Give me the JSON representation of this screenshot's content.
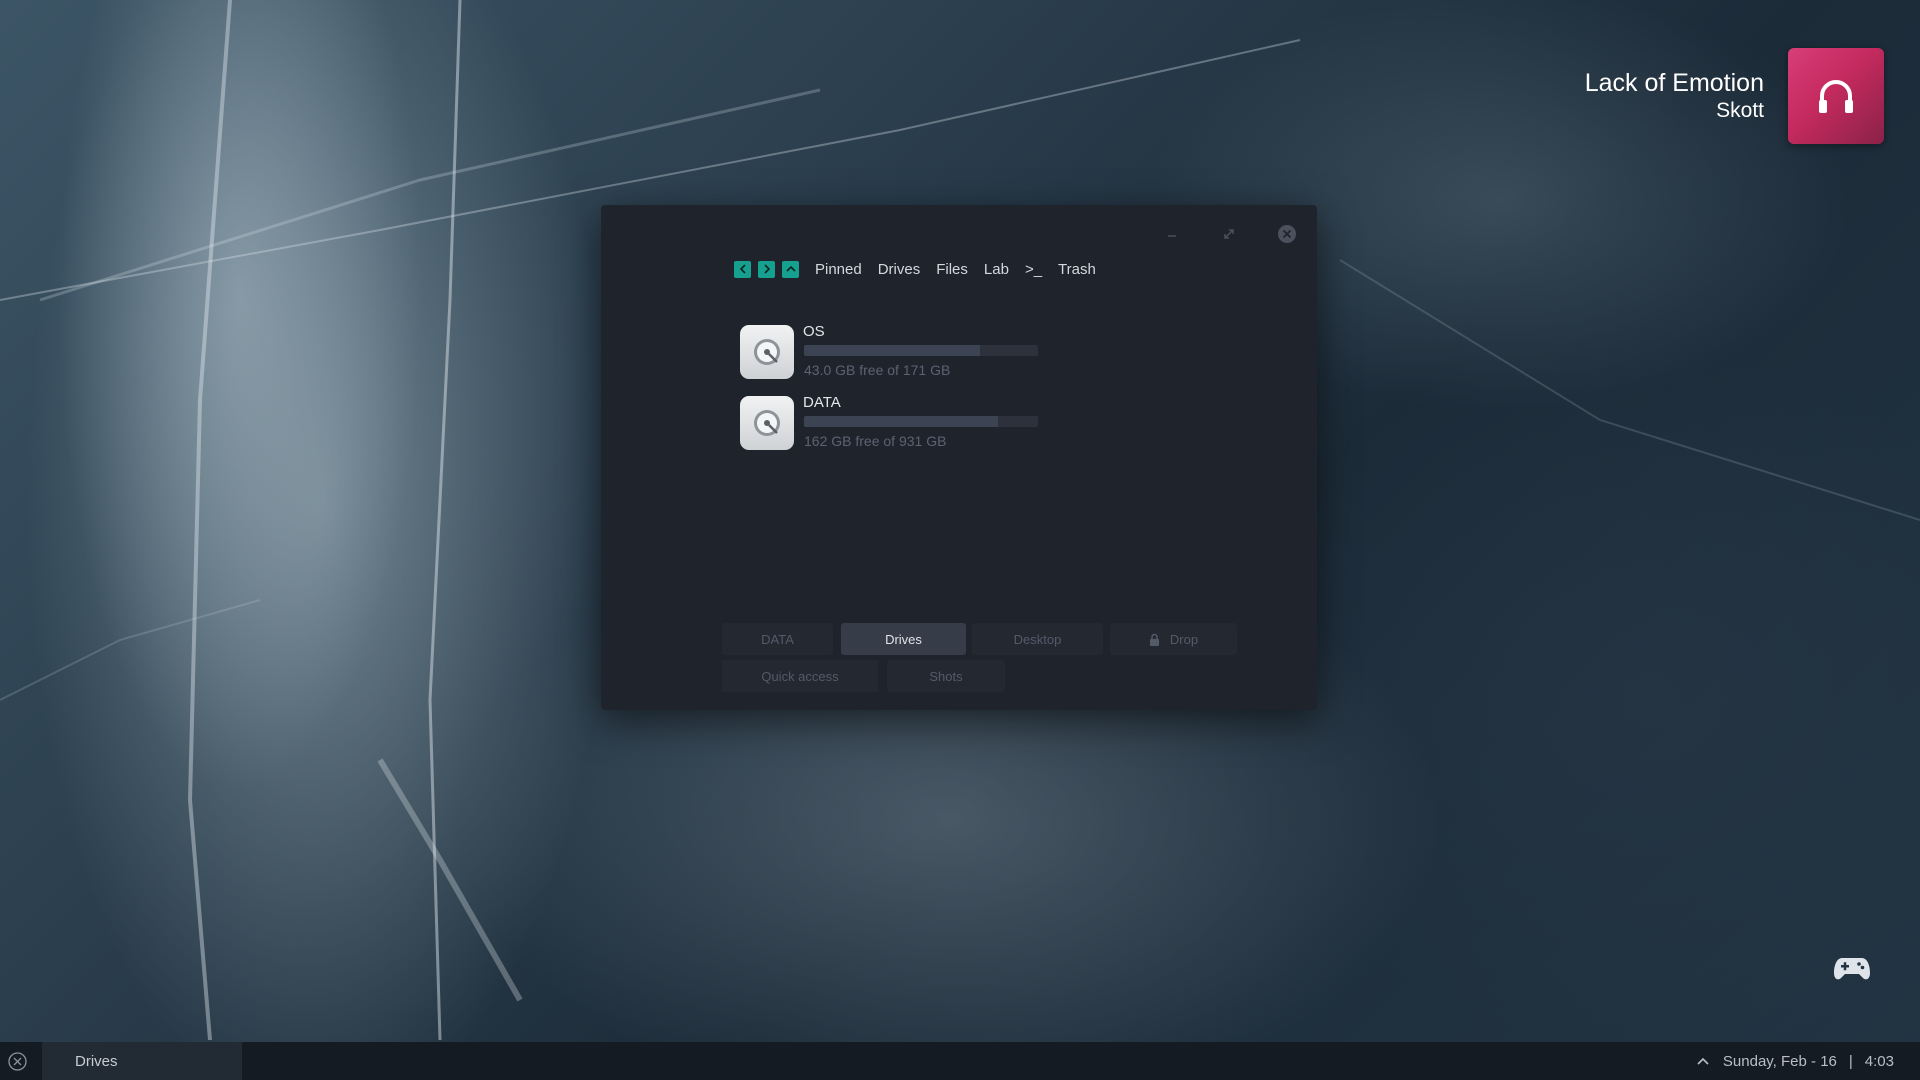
{
  "now_playing": {
    "title": "Lack of Emotion",
    "artist": "Skott",
    "art_icon": "headphones-icon",
    "accent": "#d83e78"
  },
  "window": {
    "controls": [
      "minimize-icon",
      "maximize-icon",
      "close-icon"
    ],
    "nav": {
      "back_icon": "chevron-left-icon",
      "forward_icon": "chevron-right-icon",
      "up_icon": "chevron-up-icon",
      "accent": "#15a08f",
      "crumbs": [
        "Pinned",
        "Drives",
        "Files",
        "Lab",
        ">_",
        "Trash"
      ]
    },
    "drives": [
      {
        "name": "OS",
        "free_text": "43.0 GB free of 171 GB",
        "used_fraction": 0.75,
        "icon": "hard-drive-icon"
      },
      {
        "name": "DATA",
        "free_text": "162 GB free of 931 GB",
        "used_fraction": 0.83,
        "icon": "hard-drive-icon"
      }
    ],
    "tabs": {
      "data": "DATA",
      "drives": "Drives",
      "desktop": "Desktop",
      "drop": "Drop",
      "drop_icon": "lock-icon",
      "quick": "Quick access",
      "shots": "Shots",
      "active": "Drives"
    }
  },
  "taskbar": {
    "close_icon": "close-circle-icon",
    "task_label": "Drives",
    "tray_icon": "chevron-up-icon",
    "date": "Sunday, Feb - 16",
    "separator": "|",
    "time": "4:03"
  },
  "desktop": {
    "gamepad_icon": "gamepad-icon"
  }
}
